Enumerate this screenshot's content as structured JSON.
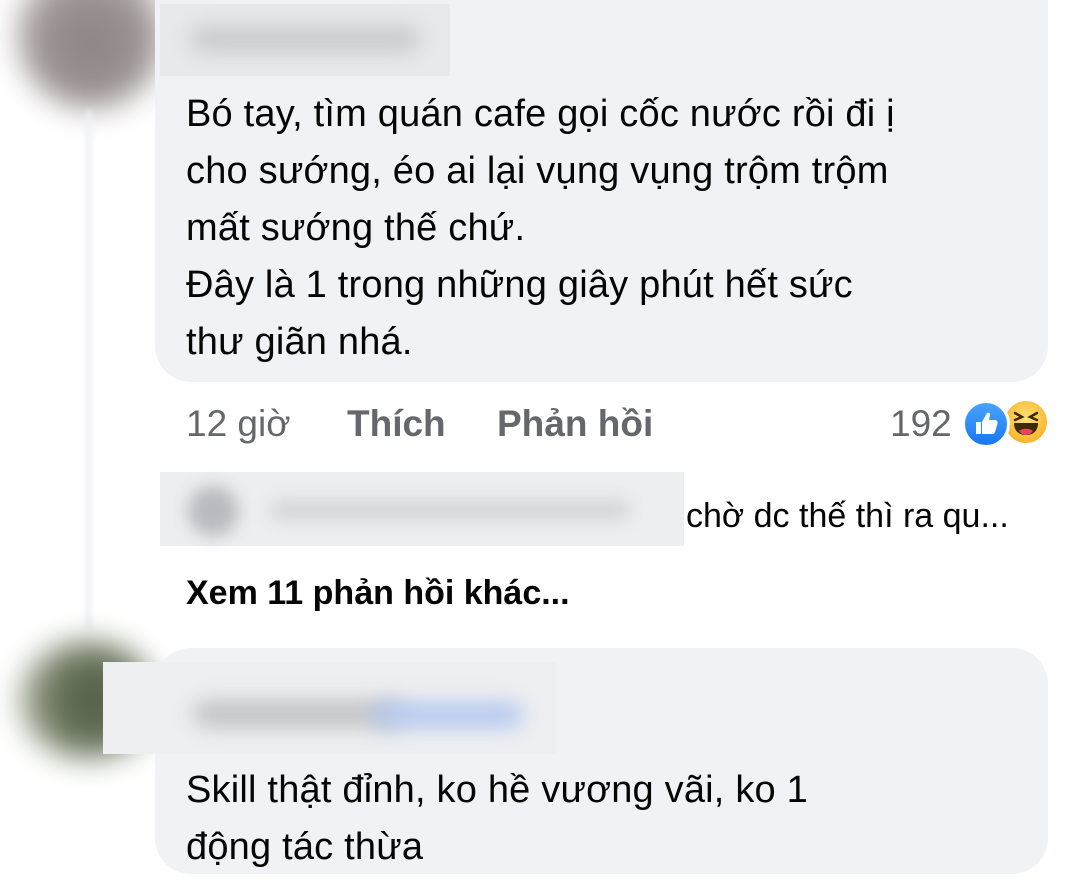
{
  "comments": [
    {
      "text_lines": [
        "Bó tay, tìm quán cafe gọi cốc nước rồi đi ị",
        "cho sướng, éo ai lại vụng vụng trộm trộm",
        "mất sướng thế chứ.",
        "Đây là 1 trong những giây phút hết sức",
        "thư giãn nhá."
      ],
      "time": "12 giờ",
      "like_label": "Thích",
      "reply_label": "Phản hồi",
      "reaction_count": "192",
      "reactions": [
        "like-icon",
        "haha-icon"
      ],
      "reply_preview": "chờ dc thế thì ra qu...",
      "more_replies": "Xem 11 phản hồi khác..."
    },
    {
      "text_lines": [
        "Skill thật đỉnh, ko hề vương vãi, ko 1",
        "động tác thừa"
      ]
    }
  ],
  "colors": {
    "bubble": "#f0f2f5",
    "secondary_text": "#65676b",
    "like_blue": "#1877f2",
    "haha_yellow": "#f7b125"
  }
}
